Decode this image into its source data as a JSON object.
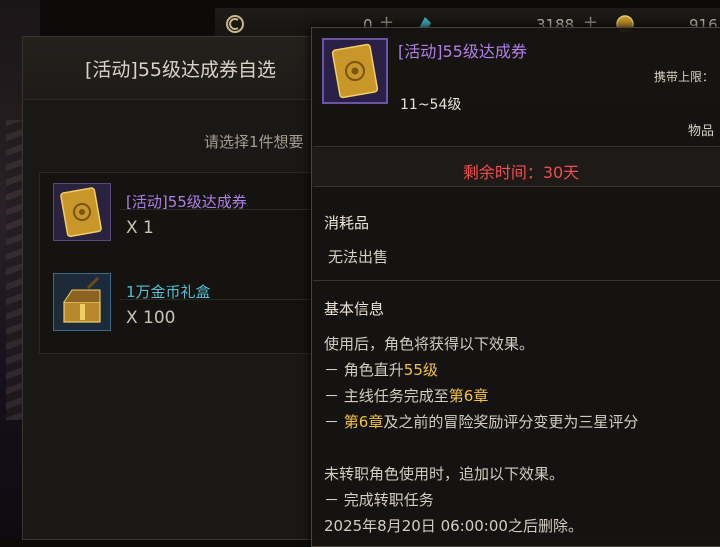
{
  "topbar": {
    "ceras": "0",
    "crystal": "3188",
    "gold": "916"
  },
  "dialog": {
    "title": "[活动]55级达成券自选",
    "prompt": "请选择1件想要",
    "rewards": [
      {
        "name": "[活动]55级达成券",
        "qty": "X 1",
        "color": "#b07ee8"
      },
      {
        "name": "1万金币礼盒",
        "qty": "X 100",
        "color": "#4ec0d8"
      }
    ]
  },
  "tooltip": {
    "name": "[活动]55级达成券",
    "level_range": "11~54级",
    "carry_limit": "携带上限：",
    "item_category": "物品",
    "remaining_time": "剩余时间：30天",
    "type": "消耗品",
    "trade": "无法出售",
    "section_title": "基本信息",
    "line1": "使用后，角色将获得以下效果。",
    "line2_prefix": "－ 角色直升",
    "line2_highlight": "55级",
    "line3_prefix": "－ 主线任务完成至",
    "line3_highlight": "第6章",
    "line4_prefix": "－ ",
    "line4_highlight": "第6章",
    "line4_suffix": "及之前的冒险奖励评分变更为三星评分",
    "line5": "未转职角色使用时，追加以下效果。",
    "line6": "－ 完成转职任务",
    "line7": "2025年8月20日 06:00:00之后删除。"
  }
}
